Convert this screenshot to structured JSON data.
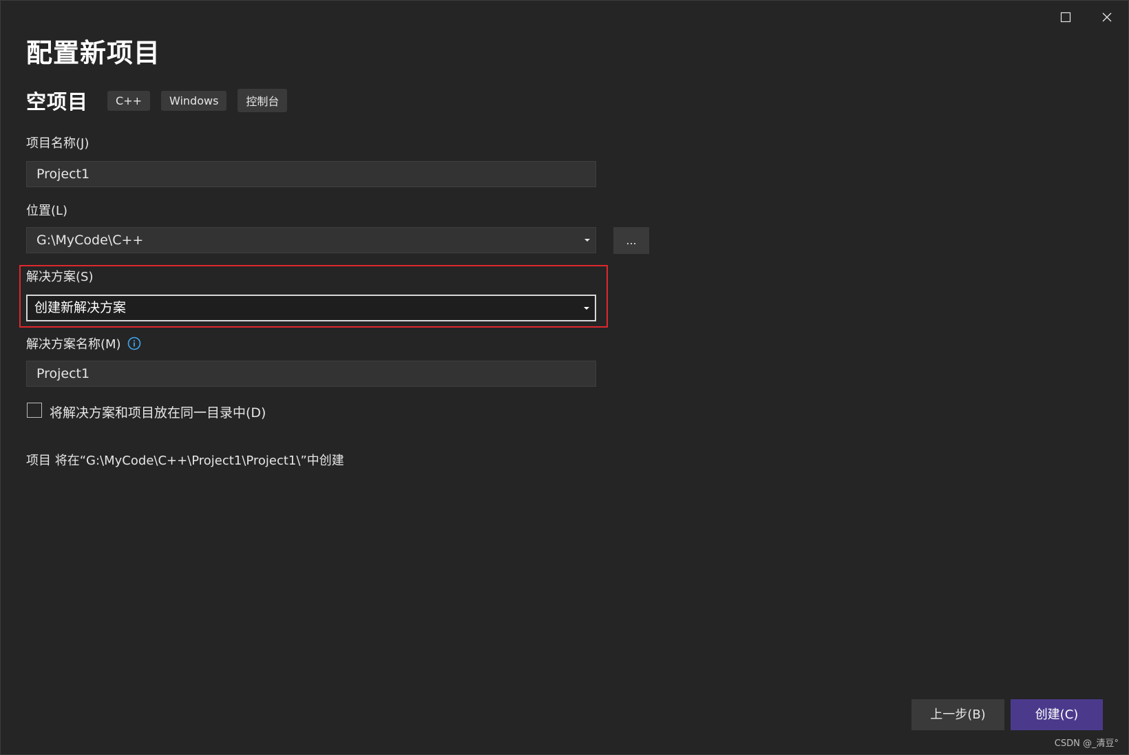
{
  "dialog": {
    "title": "配置新项目",
    "template_name": "空项目",
    "tags": [
      "C++",
      "Windows",
      "控制台"
    ]
  },
  "window_controls": {
    "maximize_icon": "maximize-icon",
    "close_icon": "close-icon"
  },
  "project_name": {
    "label": "项目名称(J)",
    "value": "Project1"
  },
  "location": {
    "label": "位置(L)",
    "value": "G:\\MyCode\\C++",
    "browse_label": "..."
  },
  "solution": {
    "label": "解决方案(S)",
    "value": "创建新解决方案"
  },
  "solution_name": {
    "label": "解决方案名称(M)",
    "value": "Project1",
    "info_icon": "info-icon"
  },
  "same_directory": {
    "label": "将解决方案和项目放在同一目录中(D)",
    "checked": false
  },
  "path_note": "项目 将在“G:\\MyCode\\C++\\Project1\\Project1\\”中创建",
  "footer": {
    "back_label": "上一步(B)",
    "create_label": "创建(C)"
  },
  "watermark": "CSDN @_清豆°",
  "colors": {
    "background": "#252525",
    "accent": "#4b3a8c",
    "highlight": "#e0272d",
    "info": "#3fa7f0"
  }
}
